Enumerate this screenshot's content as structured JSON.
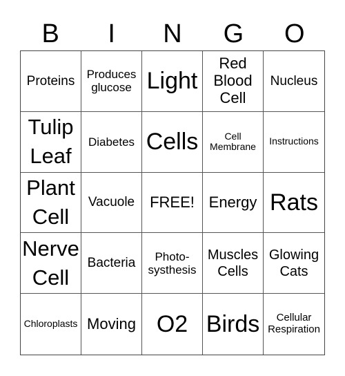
{
  "header": [
    "B",
    "I",
    "N",
    "G",
    "O"
  ],
  "cells": [
    "Proteins",
    "Produces glucose",
    "Light",
    "Red Blood Cell",
    "Nucleus",
    "Tulip Leaf",
    "Diabetes",
    "Cells",
    "Cell Membrane",
    "Instructions",
    "Plant Cell",
    "Vacuole",
    "FREE!",
    "Energy",
    "Rats",
    "Nerve Cell",
    "Bacteria",
    "Photo-systhesis",
    "Muscles Cells",
    "Glowing Cats",
    "Chloroplasts",
    "Moving",
    "O2",
    "Birds",
    "Cellular Respiration"
  ]
}
